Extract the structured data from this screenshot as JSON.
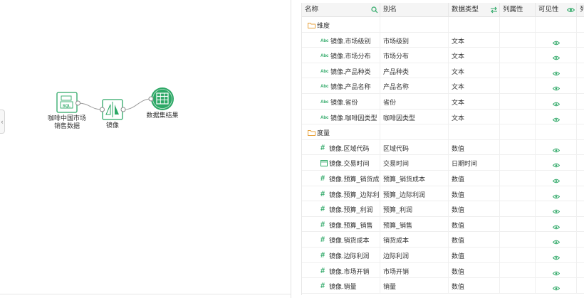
{
  "flow": {
    "source_node": {
      "icon": "sql-database-icon",
      "label_line1": "咖啡中国市场",
      "label_line2": "销售数据"
    },
    "mirror_node": {
      "icon": "mirror-icon",
      "label": "镜像"
    },
    "result_node": {
      "icon": "table-grid-icon",
      "label": "数据集结果"
    },
    "accent_color": "#2da866"
  },
  "table": {
    "headers": {
      "name": "名称",
      "alias": "别名",
      "data_type": "数据类型",
      "column_attr": "列属性",
      "visibility": "可见性",
      "extra": "列"
    },
    "groups": [
      {
        "label": "维度",
        "rows": [
          {
            "icon": "abc-icon",
            "name": "镜像.市场级别",
            "alias": "市场级别",
            "type": "文本"
          },
          {
            "icon": "abc-icon",
            "name": "镜像.市场分布",
            "alias": "市场分布",
            "type": "文本"
          },
          {
            "icon": "abc-icon",
            "name": "镜像.产品种类",
            "alias": "产品种类",
            "type": "文本"
          },
          {
            "icon": "abc-icon",
            "name": "镜像.产品名称",
            "alias": "产品名称",
            "type": "文本"
          },
          {
            "icon": "abc-icon",
            "name": "镜像.省份",
            "alias": "省份",
            "type": "文本"
          },
          {
            "icon": "abc-icon",
            "name": "镜像.咖啡因类型",
            "alias": "咖啡因类型",
            "type": "文本"
          }
        ]
      },
      {
        "label": "度量",
        "rows": [
          {
            "icon": "hash-icon",
            "name": "镜像.区域代码",
            "alias": "区域代码",
            "type": "数值"
          },
          {
            "icon": "calendar-icon",
            "name": "镜像.交易时间",
            "alias": "交易时间",
            "type": "日期时间"
          },
          {
            "icon": "hash-icon",
            "name": "镜像.预算_销货成本",
            "alias": "预算_销货成本",
            "type": "数值"
          },
          {
            "icon": "hash-icon",
            "name": "镜像.预算_边际利润",
            "alias": "预算_边际利润",
            "type": "数值"
          },
          {
            "icon": "hash-icon",
            "name": "镜像.预算_利润",
            "alias": "预算_利润",
            "type": "数值"
          },
          {
            "icon": "hash-icon",
            "name": "镜像.预算_销售",
            "alias": "预算_销售",
            "type": "数值"
          },
          {
            "icon": "hash-icon",
            "name": "镜像.销货成本",
            "alias": "销货成本",
            "type": "数值"
          },
          {
            "icon": "hash-icon",
            "name": "镜像.边际利润",
            "alias": "边际利润",
            "type": "数值"
          },
          {
            "icon": "hash-icon",
            "name": "镜像.市场开销",
            "alias": "市场开销",
            "type": "数值"
          },
          {
            "icon": "hash-icon",
            "name": "镜像.销量",
            "alias": "销量",
            "type": "数值"
          }
        ]
      }
    ]
  }
}
